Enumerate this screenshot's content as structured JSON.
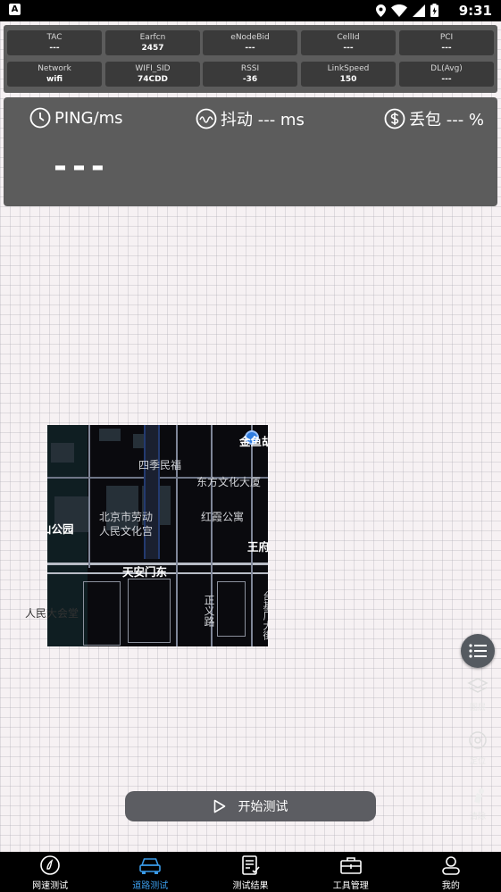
{
  "status_bar": {
    "app_badge": "A",
    "time": "9:31"
  },
  "info_row1": [
    {
      "label": "TAC",
      "value": "---"
    },
    {
      "label": "Earfcn",
      "value": "2457"
    },
    {
      "label": "eNodeBid",
      "value": "---"
    },
    {
      "label": "CellId",
      "value": "---"
    },
    {
      "label": "PCI",
      "value": "---"
    }
  ],
  "info_row2": [
    {
      "label": "Network",
      "value": "wifi"
    },
    {
      "label": "WIFI_SID",
      "value": "74CDD"
    },
    {
      "label": "RSSI",
      "value": "-36"
    },
    {
      "label": "LinkSpeed",
      "value": "150"
    },
    {
      "label": "DL(Avg)",
      "value": "---"
    }
  ],
  "ping_panel": {
    "ping_label": "PING/ms",
    "jitter_label": "抖动 --- ms",
    "loss_label": "丢包 --- %",
    "ping_value": "---"
  },
  "map": {
    "labels": {
      "l1": "金鱼胡同",
      "l2": "四季民福",
      "l3": "东方文化大厦",
      "l4": "山公园",
      "l5": "北京市劳动",
      "l6": "人民文化宫",
      "l7": "红霞公寓",
      "l8": "王府井",
      "l9": "天安门东",
      "l10": "人民大会堂",
      "l11": "正义路",
      "l12": "台基厂大街"
    }
  },
  "side_tools": {
    "t1": "图层",
    "t2": "定位",
    "t3": "清除"
  },
  "start_button": {
    "label": "开始测试"
  },
  "bottom_nav": [
    {
      "label": "网速测试",
      "icon": "speed-icon"
    },
    {
      "label": "道路测试",
      "icon": "car-icon"
    },
    {
      "label": "测试结果",
      "icon": "checklist-icon"
    },
    {
      "label": "工具管理",
      "icon": "toolbox-icon"
    },
    {
      "label": "我的",
      "icon": "person-icon"
    }
  ],
  "colors": {
    "accent": "#3a9be8",
    "panel": "#5c5c5c",
    "cell": "#3a3a3a"
  }
}
